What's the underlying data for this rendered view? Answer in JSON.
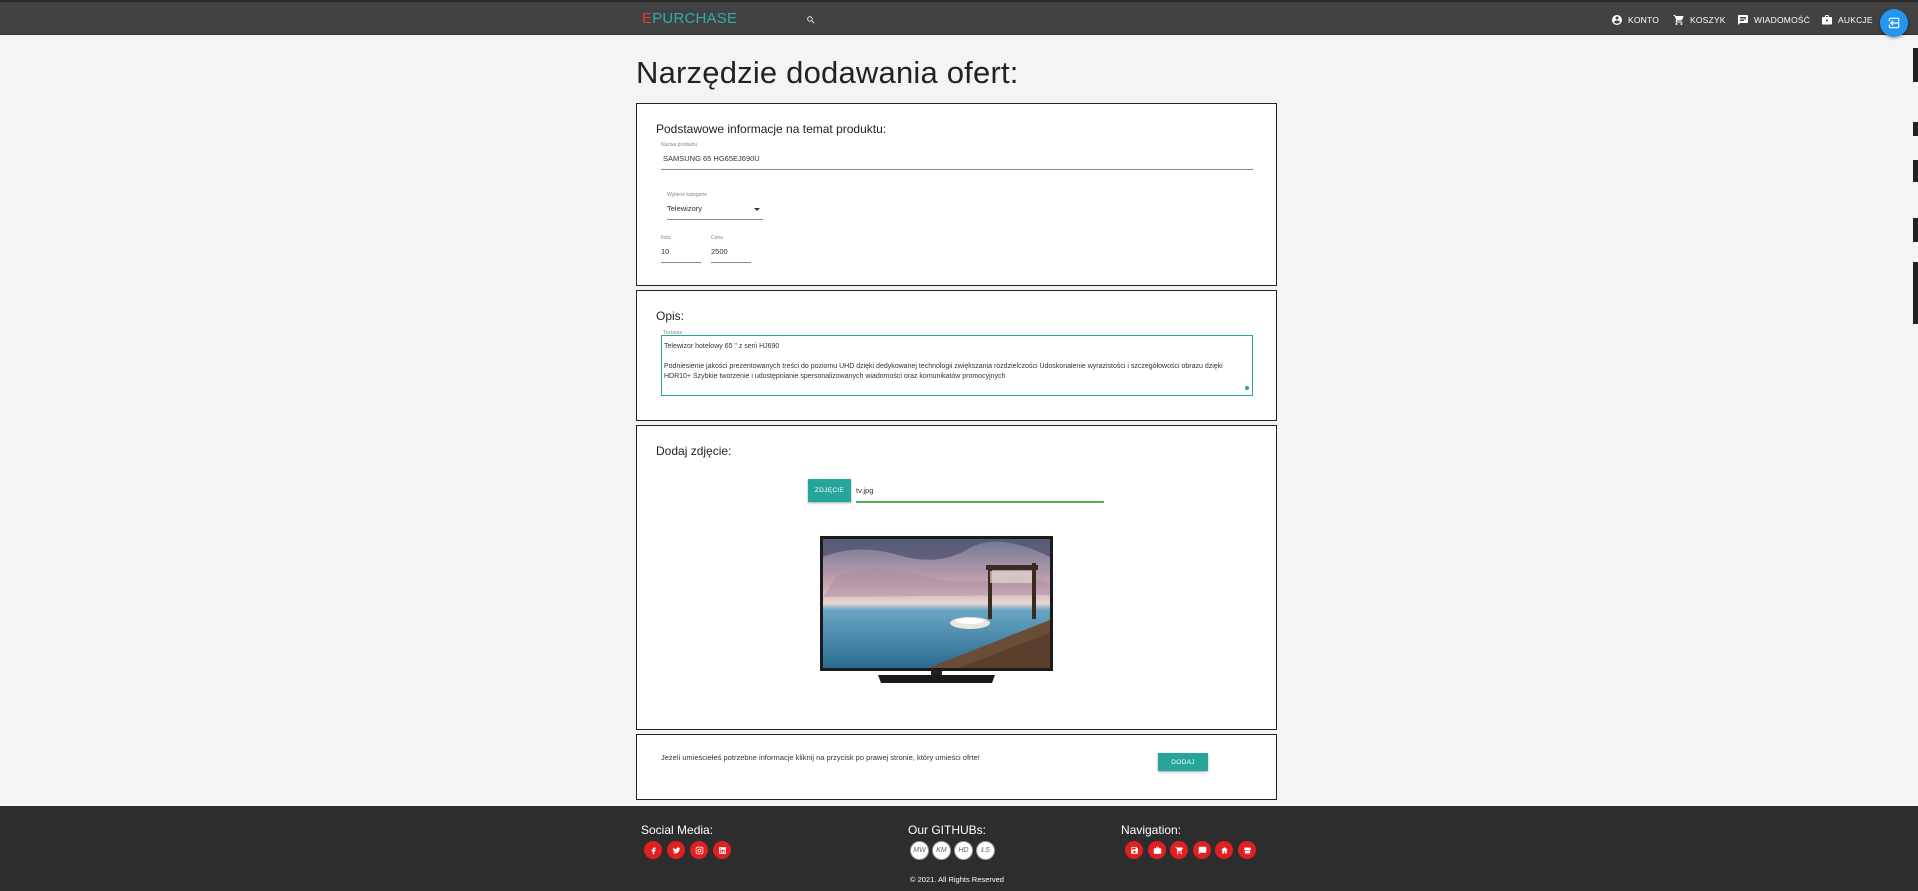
{
  "header": {
    "brand_prefix": "E",
    "brand_name": "PURCHASE",
    "nav": [
      {
        "label": "KONTO",
        "icon": "account-circle-icon"
      },
      {
        "label": "KOSZYK",
        "icon": "cart-icon"
      },
      {
        "label": "WIADOMOŚĆ",
        "icon": "message-icon"
      },
      {
        "label": "AUKCJE",
        "icon": "briefcase-icon"
      }
    ]
  },
  "page": {
    "title": "Narzędzie dodawania ofert:"
  },
  "basic": {
    "heading": "Podstawowe informacje na temat produktu:",
    "name_label": "Nazwa produktu",
    "name_value": "SAMSUNG 65 HG65EJ690U",
    "category_label": "Wybierz kategorie",
    "category_value": "Telewizory",
    "qty_label": "Ilość",
    "qty_value": "10",
    "price_label": "Cena",
    "price_value": "2500"
  },
  "desc": {
    "heading": "Opis:",
    "label": "Textarea",
    "line1": "Telewizor hotelowy 65 \" z serii HJ690",
    "line2": "Podniesienie jakości prezentowanych treści do poziomu UHD dzięki dedykowanej technologii zwiększania rozdzielczości Udoskonalenie wyrazistości i szczegółowości obrazu dzięki HDR10+ Szybkie tworzenie i udostępnianie spersonalizowanych wiadomości oraz komunikatów promocyjnych"
  },
  "photo": {
    "heading": "Dodaj zdjęcie:",
    "button_label": "ZDJĘCIE",
    "file_name": "tv.jpg"
  },
  "submit": {
    "hint": "Jeżeli umieściełeś potrzebne informacje kliknij na przycisk po prawej stronie, który umieści ofrte!",
    "button_label": "DODAJ"
  },
  "footer": {
    "social_heading": "Social Media:",
    "social_icons": [
      "facebook-icon",
      "twitter-icon",
      "instagram-icon",
      "linkedin-icon"
    ],
    "github_heading": "Our GITHUBs:",
    "githubs": [
      "MW",
      "KM",
      "HD",
      "ŁS"
    ],
    "nav_heading": "Navigation:",
    "nav_icons": [
      "save-icon",
      "briefcase-icon",
      "cart-icon",
      "chat-icon",
      "home-icon",
      "shop-icon"
    ],
    "copyright": "© 2021. All Rights Reserved"
  },
  "colors": {
    "topbar": "#424242",
    "accent": "#26a69a",
    "brand": "#2bb0ad",
    "brand_prefix": "#e53935",
    "footer": "#2d2d2d",
    "social": "#e02020",
    "fab": "#2196f3"
  }
}
